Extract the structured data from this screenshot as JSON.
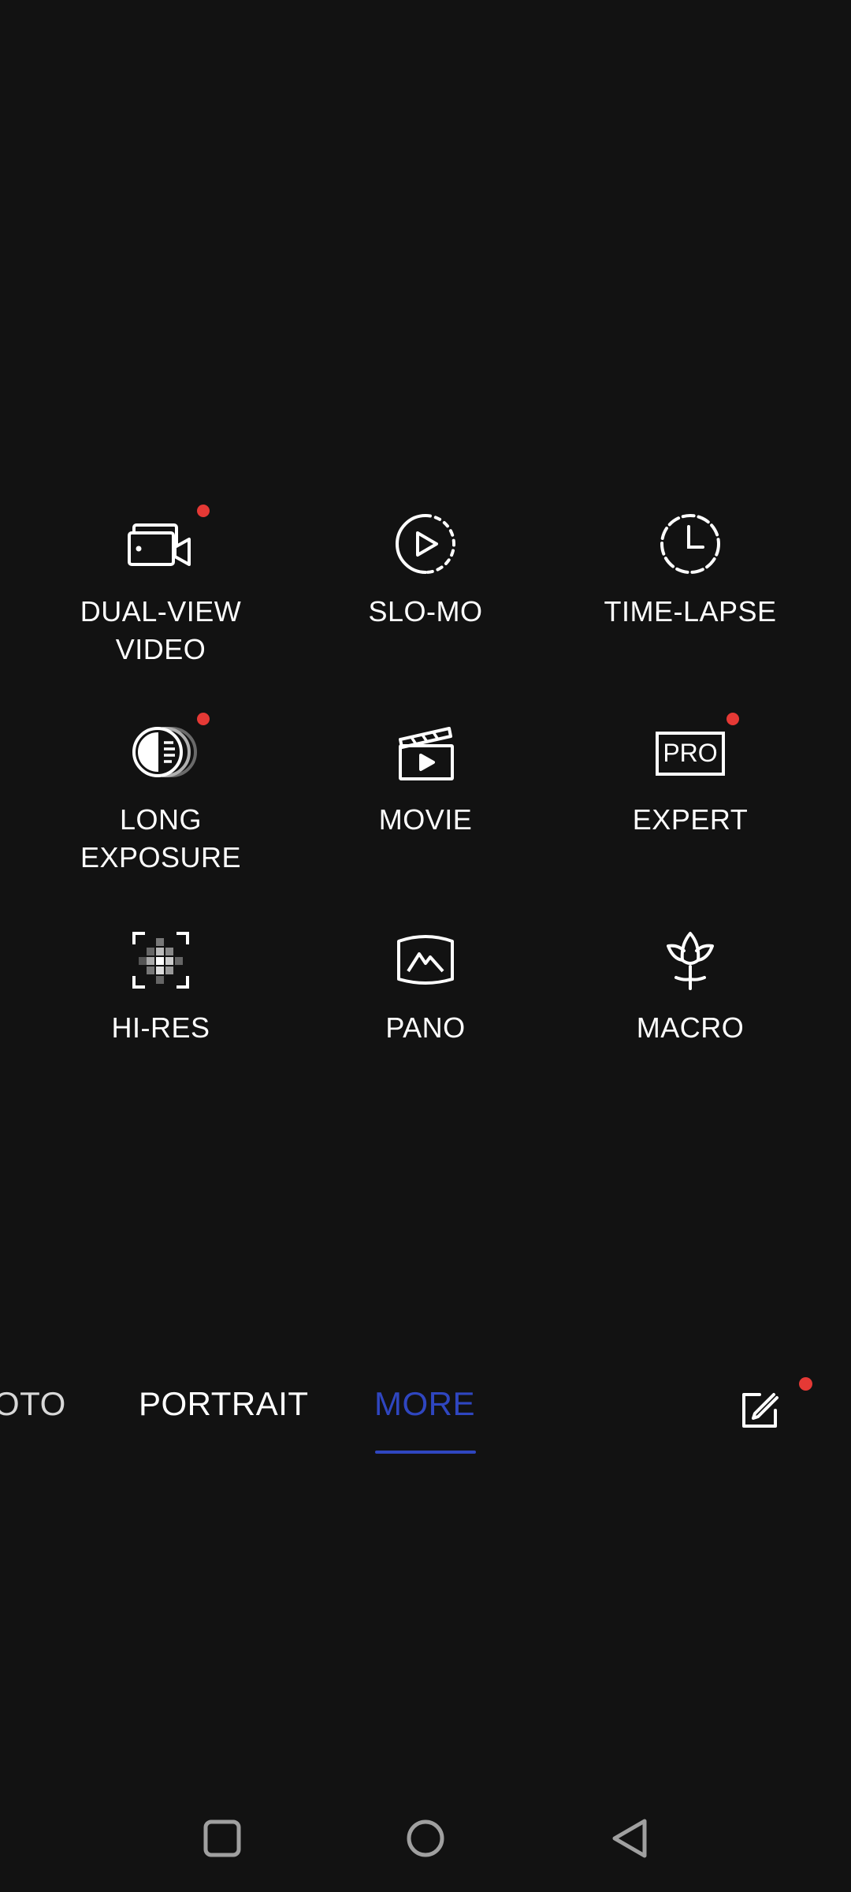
{
  "colors": {
    "background": "#121212",
    "text": "#ffffff",
    "accent": "#2f46c0",
    "badge": "#e53935",
    "nav_icon": "#a0a0a0"
  },
  "modes": [
    {
      "id": "dual-view-video",
      "label": "DUAL-VIEW\nVIDEO",
      "icon": "dual-view-video-icon",
      "badge": true
    },
    {
      "id": "slo-mo",
      "label": "SLO-MO",
      "icon": "slo-mo-icon",
      "badge": false
    },
    {
      "id": "time-lapse",
      "label": "TIME-LAPSE",
      "icon": "time-lapse-icon",
      "badge": false
    },
    {
      "id": "long-exposure",
      "label": "LONG\nEXPOSURE",
      "icon": "long-exposure-icon",
      "badge": true
    },
    {
      "id": "movie",
      "label": "MOVIE",
      "icon": "movie-clapperboard-icon",
      "badge": false
    },
    {
      "id": "expert",
      "label": "EXPERT",
      "icon": "pro-icon",
      "badge": true,
      "icon_text": "PRO"
    },
    {
      "id": "hi-res",
      "label": "HI-RES",
      "icon": "hi-res-icon",
      "badge": false
    },
    {
      "id": "pano",
      "label": "PANO",
      "icon": "pano-icon",
      "badge": false
    },
    {
      "id": "macro",
      "label": "MACRO",
      "icon": "macro-flower-icon",
      "badge": false
    }
  ],
  "mode_tabs": {
    "items": [
      {
        "label": "OTO",
        "active": false
      },
      {
        "label": "PORTRAIT",
        "active": false
      },
      {
        "label": "MORE",
        "active": true
      }
    ],
    "edit_icon": "edit-icon",
    "edit_badge": true
  },
  "system_nav": {
    "recents_icon": "recents-square-icon",
    "home_icon": "home-circle-icon",
    "back_icon": "back-triangle-icon"
  }
}
